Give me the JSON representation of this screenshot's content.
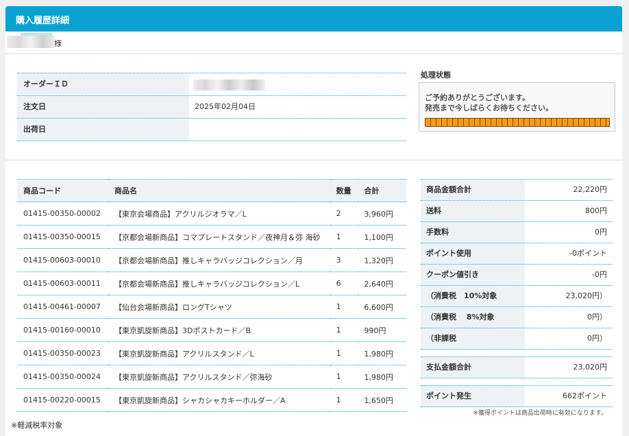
{
  "header": {
    "title": "購入履歴詳細"
  },
  "user": {
    "suffix": "様"
  },
  "order": {
    "rows": [
      {
        "label": "オーダーＩＤ",
        "value": ""
      },
      {
        "label": "注文日",
        "value": "2025年02月04日"
      },
      {
        "label": "出荷日",
        "value": ""
      }
    ]
  },
  "status": {
    "label": "処理状態",
    "message_line1": "ご予約ありがとうございます。",
    "message_line2": "発売まで今しばらくお待ちください。",
    "progress": 1.0
  },
  "items": {
    "headers": {
      "code": "商品コード",
      "name": "商品名",
      "qty": "数量",
      "total": "合計"
    },
    "rows": [
      {
        "code": "01415-00350-00002",
        "name": "【東京会場商品】アクリルジオラマ／L",
        "qty": "2",
        "total": "3,960円"
      },
      {
        "code": "01415-00350-00015",
        "name": "【京都会場新商品】コマプレートスタンド／夜神月＆弥 海砂",
        "qty": "1",
        "total": "1,100円"
      },
      {
        "code": "01415-00603-00010",
        "name": "【京都会場新商品】推しキャラバッジコレクション／月",
        "qty": "3",
        "total": "1,320円"
      },
      {
        "code": "01415-00603-00011",
        "name": "【京都会場新商品】推しキャラバッジコレクション／L",
        "qty": "6",
        "total": "2,640円"
      },
      {
        "code": "01415-00461-00007",
        "name": "【仙台会場新商品】ロングTシャツ",
        "qty": "1",
        "total": "6,600円"
      },
      {
        "code": "01415-00160-00010",
        "name": "【東京凱旋新商品】3Dポストカード／B",
        "qty": "1",
        "total": "990円"
      },
      {
        "code": "01415-00350-00023",
        "name": "【東京凱旋新商品】アクリルスタンド／L",
        "qty": "1",
        "total": "1,980円"
      },
      {
        "code": "01415-00350-00024",
        "name": "【東京凱旋新商品】アクリルスタンド／弥海砂",
        "qty": "1",
        "total": "1,980円"
      },
      {
        "code": "01415-00220-00015",
        "name": "【東京凱旋新商品】シャカシャカキーホルダー／A",
        "qty": "1",
        "total": "1,650円"
      }
    ]
  },
  "footnote": "※軽減税率対象",
  "summary": {
    "rows": [
      {
        "label": "商品金額合計",
        "value": "22,220円"
      },
      {
        "label": "送料",
        "value": "800円"
      },
      {
        "label": "手数料",
        "value": "0円"
      },
      {
        "label": "ポイント使用",
        "value": "-0ポイント"
      },
      {
        "label": "クーポン値引き",
        "value": "-0円"
      },
      {
        "label": "（消費税　10%対象",
        "value": "23,020円）"
      },
      {
        "label": "（消費税　 8%対象",
        "value": "0円）"
      },
      {
        "label": "（非課税",
        "value": "0円）"
      }
    ],
    "payment": {
      "label": "支払金額合計",
      "value": "23,020円"
    },
    "points": {
      "label": "ポイント発生",
      "value": "662ポイント"
    },
    "note": "※獲得ポイントは商品出荷時に有効になります。"
  }
}
